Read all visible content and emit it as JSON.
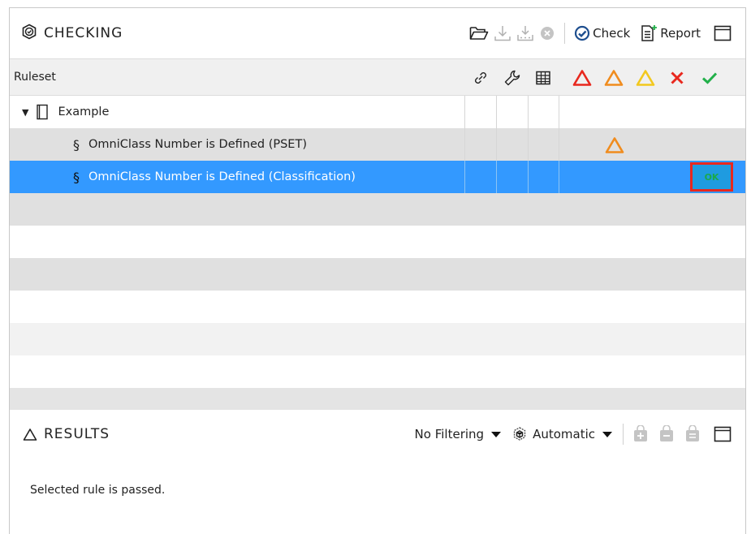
{
  "checking": {
    "title": "CHECKING",
    "check_label": "Check",
    "report_label": "Report"
  },
  "columns": {
    "ruleset_label": "Ruleset",
    "severity_colors": {
      "critical": "#e8281e",
      "moderate": "#f08c1e",
      "low": "#f2c81e",
      "failed": "#e8281e",
      "passed": "#22b04a"
    }
  },
  "tree": {
    "root_label": "Example",
    "rules": [
      {
        "symbol": "§",
        "label": "OmniClass Number is Defined (PSET)",
        "status": "moderate"
      },
      {
        "symbol": "§",
        "label": "OmniClass Number is Defined (Classification)",
        "status": "passed",
        "badge": "OK"
      }
    ]
  },
  "results": {
    "title": "RESULTS",
    "filter_label": "No Filtering",
    "mode_label": "Automatic",
    "message": "Selected rule is passed."
  },
  "colors": {
    "selection": "#3399ff",
    "badge_border": "#e8281e",
    "badge_text": "#1aaa4a",
    "check_icon": "#1f6fd1"
  }
}
